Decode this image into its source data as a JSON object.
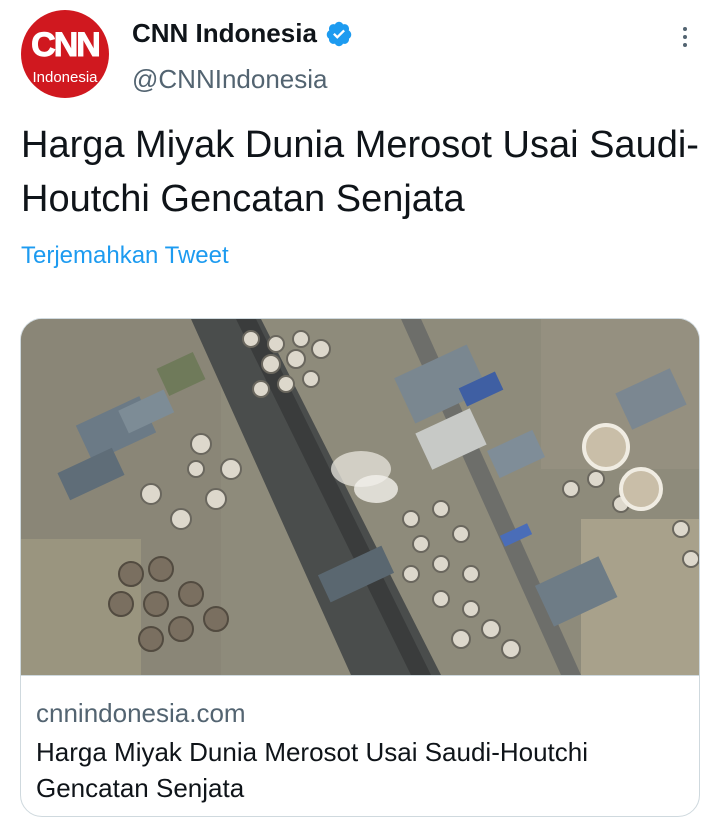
{
  "author": {
    "avatar_logo": "CNN",
    "avatar_sub": "Indonesia",
    "name": "CNN Indonesia",
    "handle": "@CNNIndonesia",
    "verified": true
  },
  "tweet": {
    "text": "Harga Miyak Dunia Merosot Usai Saudi-Houtchi Gencatan Senjata",
    "translate_label": "Terjemahkan Tweet"
  },
  "card": {
    "image_description": "satellite-image",
    "domain": "cnnindonesia.com",
    "title": "Harga Miyak Dunia Merosot Usai Saudi-Houtchi Gencatan Senjata"
  },
  "icons": {
    "verified": "verified-badge-icon",
    "more": "more-options-icon"
  },
  "colors": {
    "brand_red": "#d0181f",
    "link_blue": "#1d9bf0",
    "secondary_text": "#536471",
    "verified_blue": "#1d9bf0"
  }
}
